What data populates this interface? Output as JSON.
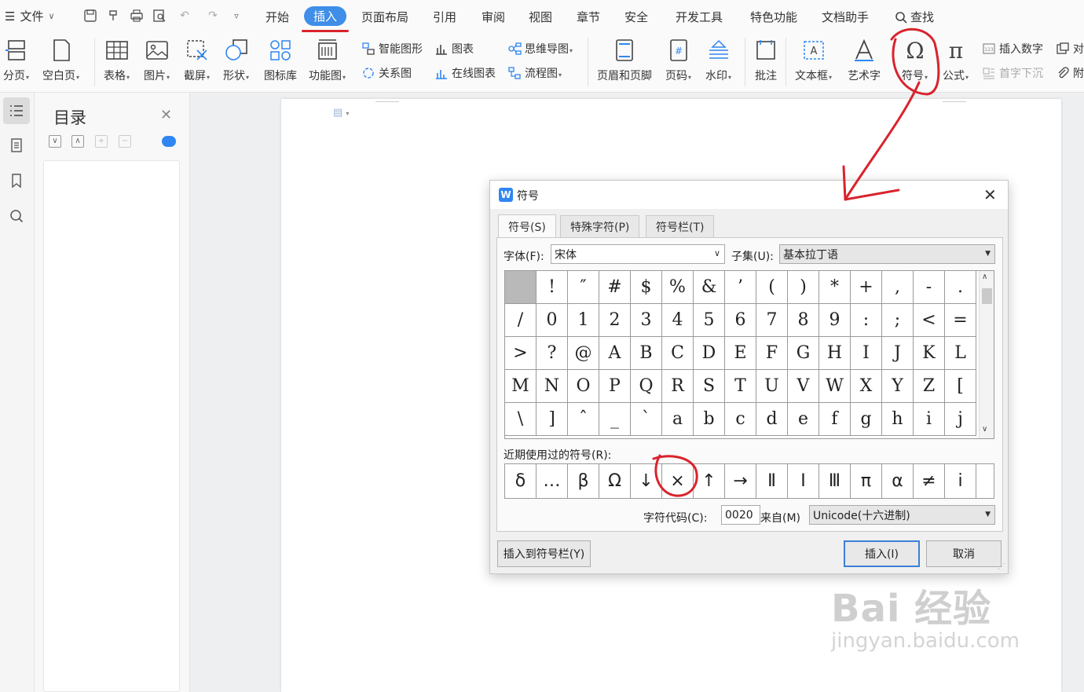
{
  "menubar": {
    "file_label": "文件",
    "tabs": [
      "开始",
      "插入",
      "页面布局",
      "引用",
      "审阅",
      "视图",
      "章节",
      "安全",
      "开发工具",
      "特色功能",
      "文档助手"
    ],
    "active_tab": "插入",
    "search_label": "查找"
  },
  "ribbon": {
    "page_break": "分页",
    "blank_page": "空白页",
    "table": "表格",
    "picture": "图片",
    "screenshot": "截屏",
    "shape": "形状",
    "icon_lib": "图标库",
    "func_chart": "功能图",
    "smart_shape": "智能图形",
    "chart": "图表",
    "mindmap": "思维导图",
    "relation": "关系图",
    "online_chart": "在线图表",
    "flowchart": "流程图",
    "header_footer": "页眉和页脚",
    "page_number": "页码",
    "watermark": "水印",
    "comment": "批注",
    "textbox": "文本框",
    "wordart": "艺术字",
    "symbol": "符号",
    "formula": "公式",
    "insert_number": "插入数字",
    "dropcap": "首字下沉",
    "object": "对",
    "attach": "附"
  },
  "toc": {
    "title": "目录"
  },
  "dialog": {
    "title": "符号",
    "tabs": [
      "符号(S)",
      "特殊字符(P)",
      "符号栏(T)"
    ],
    "font_label": "字体(F):",
    "font_value": "宋体",
    "subset_label": "子集(U):",
    "subset_value": "基本拉丁语",
    "symbols": [
      " ",
      "!",
      "″",
      "#",
      "$",
      "%",
      "&",
      "’",
      "(",
      ")",
      "*",
      "+",
      ",",
      "-",
      ".",
      "/",
      "0",
      "1",
      "2",
      "3",
      "4",
      "5",
      "6",
      "7",
      "8",
      "9",
      ":",
      ";",
      "<",
      "=",
      ">",
      "?",
      "@",
      "A",
      "B",
      "C",
      "D",
      "E",
      "F",
      "G",
      "H",
      "I",
      "J",
      "K",
      "L",
      "M",
      "N",
      "O",
      "P",
      "Q",
      "R",
      "S",
      "T",
      "U",
      "V",
      "W",
      "X",
      "Y",
      "Z",
      "[",
      "\\",
      "]",
      "ˆ",
      "_",
      "`",
      "a",
      "b",
      "c",
      "d",
      "e",
      "f",
      "g",
      "h",
      "i",
      "j"
    ],
    "recent_label": "近期使用过的符号(R):",
    "recent": [
      "δ",
      "…",
      "β",
      "Ω",
      "↓",
      "×",
      "↑",
      "→",
      "Ⅱ",
      "Ⅰ",
      "Ⅲ",
      "π",
      "α",
      "≠",
      "i"
    ],
    "code_label": "字符代码(C):",
    "code_value": "0020",
    "from_label": "来自(M)",
    "from_value": "Unicode(十六进制)",
    "insert_to_bar": "插入到符号栏(Y)",
    "insert": "插入(I)",
    "cancel": "取消"
  },
  "watermark": {
    "brand": "Bai 经验",
    "url": "jingyan.baidu.com"
  },
  "colors": {
    "accent": "#3f8ee8",
    "annotation": "#d9232c"
  }
}
